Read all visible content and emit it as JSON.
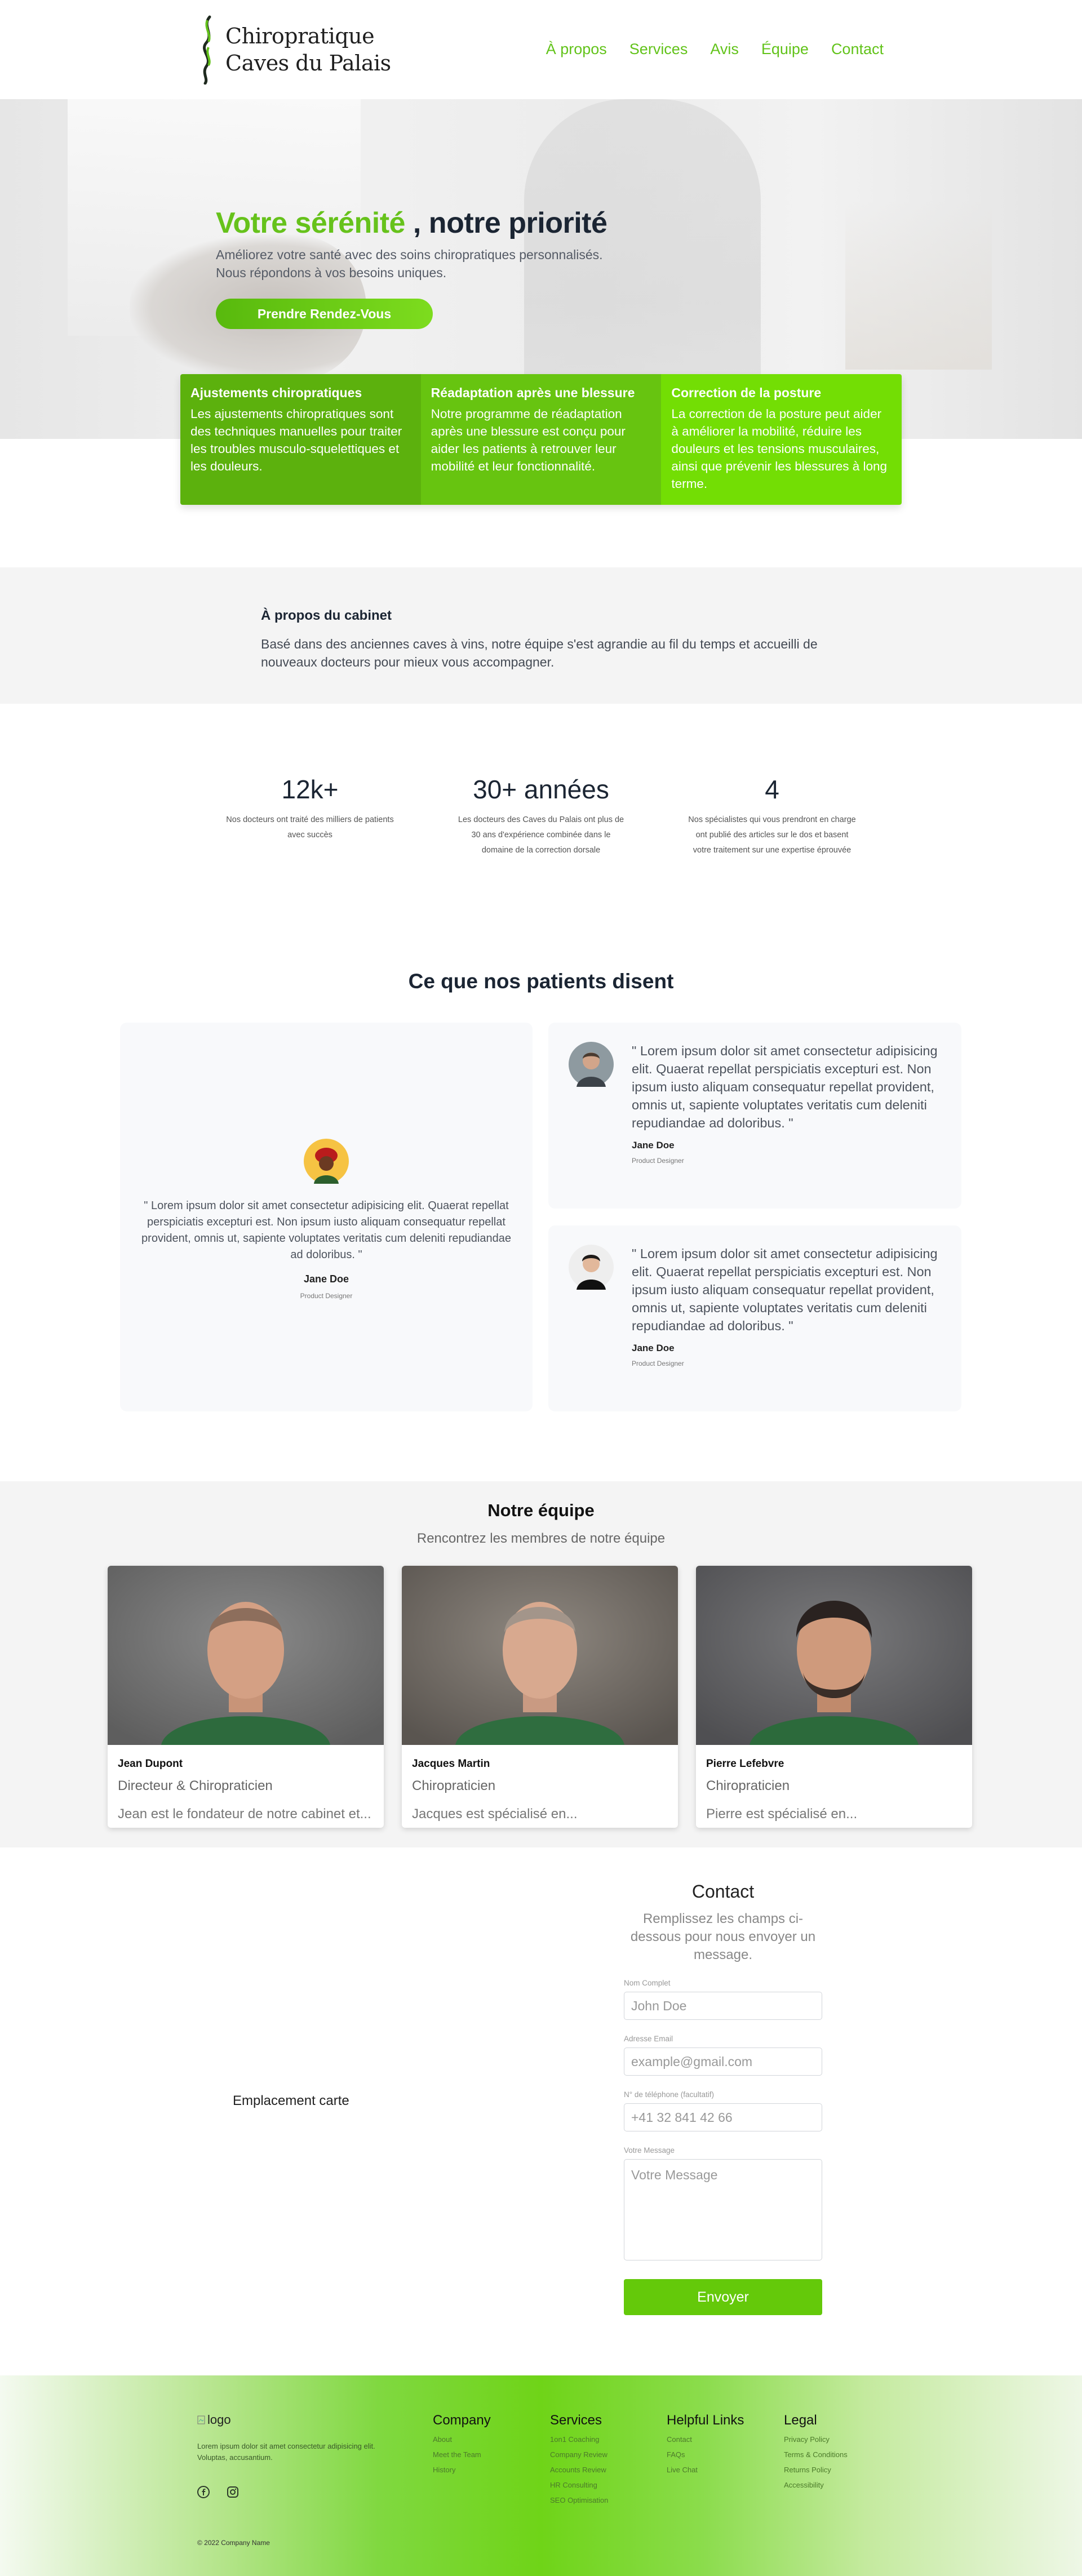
{
  "brand": {
    "line1": "Chiropratique",
    "line2": "Caves du Palais"
  },
  "nav": [
    "À propos",
    "Services",
    "Avis",
    "Équipe",
    "Contact"
  ],
  "hero": {
    "title_accent": "Votre sérénité",
    "title_rest": ", notre priorité",
    "subtitle": "Améliorez votre santé avec des soins chiropratiques personnalisés. Nous répondons à vos besoins uniques.",
    "cta": "Prendre Rendez-Vous"
  },
  "features": [
    {
      "title": "Ajustements chiropratiques",
      "text": "Les ajustements chiropratiques sont des techniques manuelles pour traiter les troubles musculo-squelettiques et les douleurs."
    },
    {
      "title": "Réadaptation après une blessure",
      "text": "Notre programme de réadaptation après une blessure est conçu pour aider les patients à retrouver leur mobilité et leur fonctionnalité."
    },
    {
      "title": "Correction de la posture",
      "text": "La correction de la posture peut aider à améliorer la mobilité, réduire les douleurs et les tensions musculaires, ainsi que prévenir les blessures à long terme."
    }
  ],
  "about": {
    "title": "À propos du cabinet",
    "text": "Basé dans des anciennes caves à vins, notre équipe s'est agrandie au fil du temps et accueilli de nouveaux docteurs pour mieux vous accompagner."
  },
  "stats": [
    {
      "value": "12k+",
      "desc": "Nos docteurs ont traité des milliers de patients avec succès"
    },
    {
      "value": "30+ années",
      "desc": "Les docteurs des Caves du Palais ont plus de 30 ans d'expérience combinée dans le domaine de la correction dorsale"
    },
    {
      "value": "4",
      "desc": "Nos spécialistes qui vous prendront en charge ont publié des articles sur le dos et basent votre traitement sur une expertise éprouvée"
    }
  ],
  "testimonials": {
    "title": "Ce que nos patients disent",
    "items": [
      {
        "quote": "\" Lorem ipsum dolor sit amet consectetur adipisicing elit. Quaerat repellat perspiciatis excepturi est. Non ipsum iusto aliquam consequatur repellat provident, omnis ut, sapiente voluptates veritatis cum deleniti repudiandae ad doloribus. \"",
        "name": "Jane Doe",
        "role": "Product Designer"
      },
      {
        "quote": "\" Lorem ipsum dolor sit amet consectetur adipisicing elit. Quaerat repellat perspiciatis excepturi est. Non ipsum iusto aliquam consequatur repellat provident, omnis ut, sapiente voluptates veritatis cum deleniti repudiandae ad doloribus. \"",
        "name": "Jane Doe",
        "role": "Product Designer"
      },
      {
        "quote": "\" Lorem ipsum dolor sit amet consectetur adipisicing elit. Quaerat repellat perspiciatis excepturi est. Non ipsum iusto aliquam consequatur repellat provident, omnis ut, sapiente voluptates veritatis cum deleniti repudiandae ad doloribus. \"",
        "name": "Jane Doe",
        "role": "Product Designer"
      }
    ]
  },
  "team": {
    "title": "Notre équipe",
    "subtitle": "Rencontrez les membres de notre équipe",
    "members": [
      {
        "name": "Jean Dupont",
        "role": "Directeur & Chiropraticien",
        "desc": "Jean est le fondateur de notre cabinet et..."
      },
      {
        "name": "Jacques Martin",
        "role": "Chiropraticien",
        "desc": "Jacques est spécialisé en..."
      },
      {
        "name": "Pierre Lefebvre",
        "role": "Chiropraticien",
        "desc": "Pierre est spécialisé en..."
      }
    ]
  },
  "contact": {
    "map_label": "Emplacement carte",
    "title": "Contact",
    "subtitle": "Remplissez les champs ci-dessous pour nous envoyer un message.",
    "fields": {
      "name_label": "Nom Complet",
      "name_placeholder": "John Doe",
      "email_label": "Adresse Email",
      "email_placeholder": "example@gmail.com",
      "phone_label": "N° de téléphone (facultatif)",
      "phone_placeholder": "+41 32 841 42 66",
      "message_label": "Votre Message",
      "message_placeholder": "Votre Message"
    },
    "submit": "Envoyer"
  },
  "footer": {
    "logo_alt": "logo",
    "about": "Lorem ipsum dolor sit amet consectetur adipisicing elit. Voluptas, accusantium.",
    "copyright": "© 2022 Company Name",
    "columns": [
      {
        "title": "Company",
        "links": [
          "About",
          "Meet the Team",
          "History"
        ]
      },
      {
        "title": "Services",
        "links": [
          "1on1 Coaching",
          "Company Review",
          "Accounts Review",
          "HR Consulting",
          "SEO Optimisation"
        ]
      },
      {
        "title": "Helpful Links",
        "links": [
          "Contact",
          "FAQs",
          "Live Chat"
        ]
      },
      {
        "title": "Legal",
        "links": [
          "Privacy Policy",
          "Terms & Conditions",
          "Returns Policy",
          "Accessibility"
        ]
      }
    ]
  },
  "colors": {
    "accent": "#66c21b",
    "feature1": "#5cb10d",
    "feature2": "#67c410",
    "feature3": "#73de04",
    "button": "#64c90a"
  },
  "icons": [
    "spine-logo-icon",
    "facebook-icon",
    "instagram-icon",
    "broken-image-icon"
  ]
}
